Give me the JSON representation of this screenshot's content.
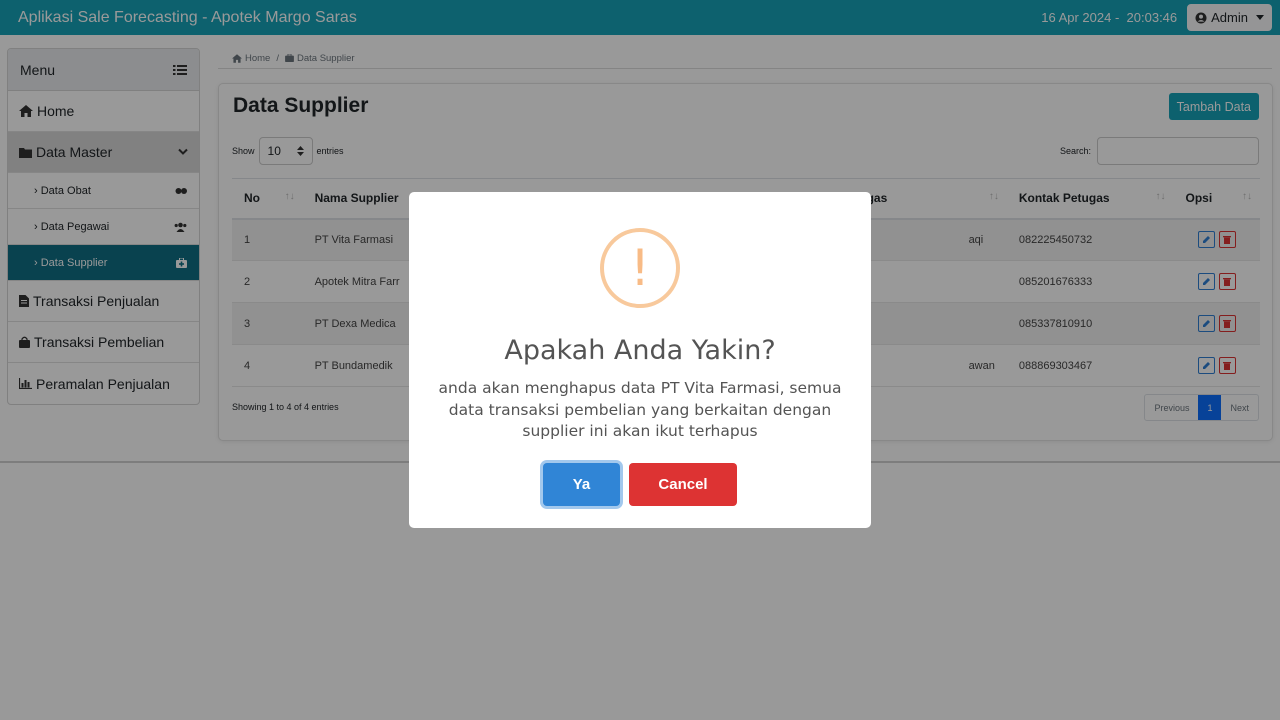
{
  "navbar": {
    "app_title": "Aplikasi Sale Forecasting - Apotek Margo Saras",
    "date": "16 Apr 2024",
    "time": "20:03:46",
    "user_label": "Admin"
  },
  "sidebar": {
    "header": "Menu",
    "home": "Home",
    "data_master": "Data Master",
    "sub_items": [
      {
        "label": "Data Obat",
        "icon": "pills-icon"
      },
      {
        "label": "Data Pegawai",
        "icon": "users-icon"
      },
      {
        "label": "Data Supplier",
        "icon": "medkit-icon"
      }
    ],
    "items": [
      {
        "label": "Transaksi Penjualan",
        "icon": "file-invoice-icon"
      },
      {
        "label": "Transaksi Pembelian",
        "icon": "shopping-bag-icon"
      },
      {
        "label": "Peramalan Penjualan",
        "icon": "chart-bar-icon"
      }
    ]
  },
  "breadcrumb": {
    "home": "Home",
    "sep": "/",
    "current": "Data Supplier"
  },
  "main": {
    "title": "Data Supplier",
    "add_button": "Tambah Data",
    "show_label": "Show",
    "entries_value": "10",
    "entries_label": "entries",
    "search_label": "Search:",
    "columns": [
      "No",
      "Nama Supplier",
      "gas",
      "Kontak Petugas",
      "Opsi"
    ],
    "rows": [
      {
        "no": "1",
        "nama": "PT Vita Farmasi",
        "petugas": "aqi",
        "kontak": "082225450732"
      },
      {
        "no": "2",
        "nama": "Apotek Mitra Farr",
        "petugas": "",
        "kontak": "085201676333"
      },
      {
        "no": "3",
        "nama": "PT Dexa Medica",
        "petugas": "",
        "kontak": "085337810910"
      },
      {
        "no": "4",
        "nama": "PT Bundamedik",
        "petugas": "awan",
        "kontak": "088869303467"
      }
    ],
    "info": "Showing 1 to 4 of 4 entries",
    "pager": {
      "previous": "Previous",
      "current": "1",
      "next": "Next"
    }
  },
  "modal": {
    "icon": "!",
    "title": "Apakah Anda Yakin?",
    "text": "anda akan menghapus data PT Vita Farmasi, semua data transaksi pembelian yang berkaitan dengan supplier ini akan ikut terhapus",
    "confirm": "Ya",
    "cancel": "Cancel"
  },
  "colors": {
    "navbar": "#17a2b8",
    "active_sidebar": "#0f6e84",
    "confirm": "#3085d6",
    "cancel": "#dd3333",
    "warning": "#f8bb86"
  }
}
